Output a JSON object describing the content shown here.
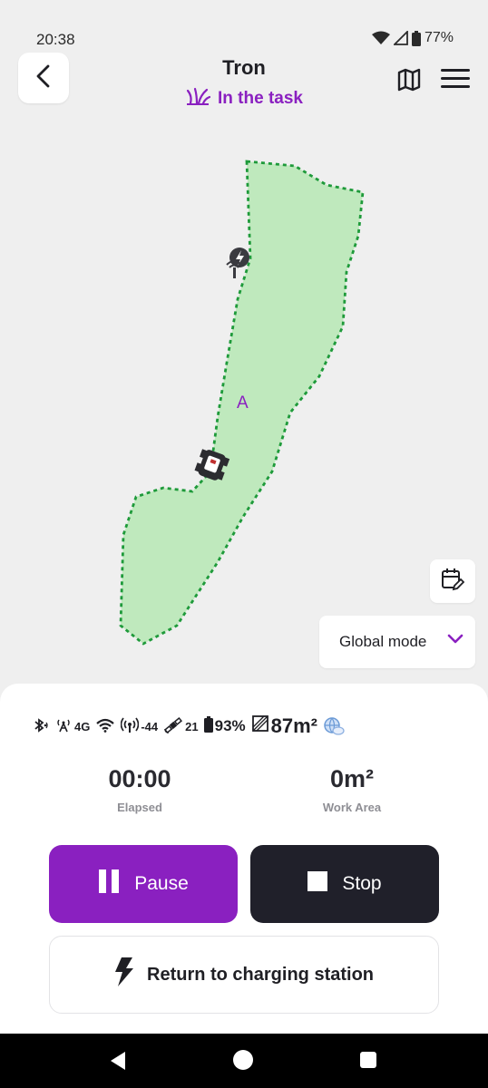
{
  "status": {
    "time": "20:38",
    "battery": "77%"
  },
  "header": {
    "title": "Tron",
    "task_status": "In the task"
  },
  "map": {
    "zone_label": "A",
    "mode": "Global mode",
    "zone_fill_color": "#bfe9bd",
    "zone_border_color": "#1e9a3a"
  },
  "stats": {
    "network": "4G",
    "signal": "-44",
    "satellites": "21",
    "battery": "93%",
    "area": "87m²"
  },
  "metrics": {
    "elapsed_value": "00:00",
    "elapsed_label": "Elapsed",
    "work_area_value": "0m²",
    "work_area_label": "Work Area"
  },
  "actions": {
    "pause_label": "Pause",
    "stop_label": "Stop",
    "return_label": "Return to charging station"
  },
  "colors": {
    "accent": "#8a20c0",
    "dark_button": "#20202a"
  }
}
